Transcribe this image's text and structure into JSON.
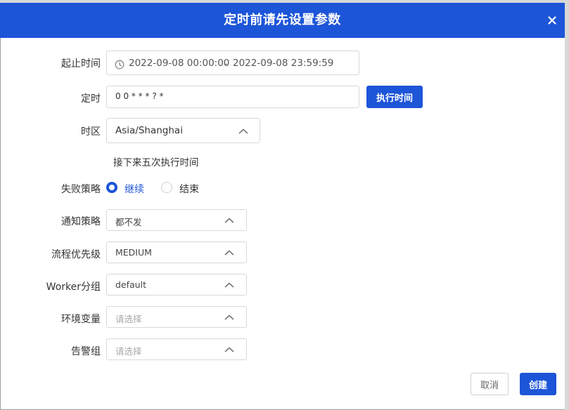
{
  "dialog": {
    "title": "定时前请先设置参数",
    "close_symbol": "×"
  },
  "form": {
    "time_range": {
      "label": "起止时间",
      "start": "2022-09-08 00:00:00",
      "separator": "-",
      "end": "2022-09-08 23:59:59"
    },
    "crontab": {
      "label": "定时",
      "value": "0 0 * * * ? *",
      "execute_button": "执行时间"
    },
    "timezone": {
      "label": "时区",
      "value": "Asia/Shanghai"
    },
    "next_five": {
      "text": "接下来五次执行时间"
    },
    "failure_strategy": {
      "label": "失败策略",
      "options": [
        {
          "label": "继续",
          "selected": true
        },
        {
          "label": "结束",
          "selected": false
        }
      ]
    },
    "notify_strategy": {
      "label": "通知策略",
      "value": "都不发"
    },
    "priority": {
      "label": "流程优先级",
      "value": "MEDIUM"
    },
    "worker_group": {
      "label": "Worker分组",
      "value": "default"
    },
    "environment": {
      "label": "环境变量",
      "placeholder": "请选择"
    },
    "alert_group": {
      "label": "告警组",
      "placeholder": "请选择"
    }
  },
  "footer": {
    "cancel": "取消",
    "create": "创建"
  },
  "colors": {
    "primary": "#1d55d8",
    "border": "#d9d9d9"
  },
  "icons": {
    "clock": "clock-icon",
    "chevron": "chevron-up-icon",
    "close": "close-icon"
  }
}
